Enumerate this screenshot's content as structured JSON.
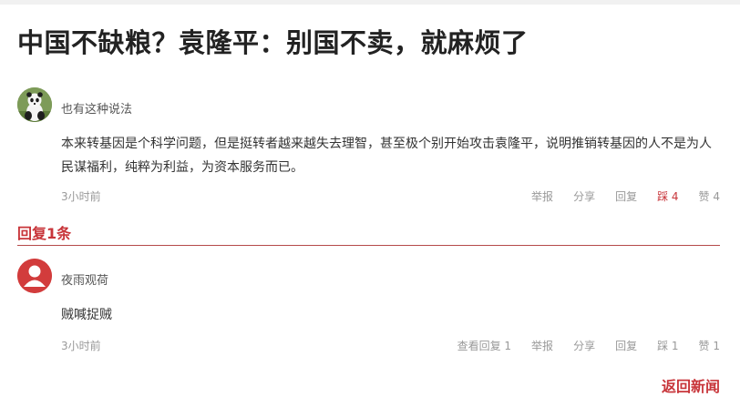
{
  "article": {
    "title": "中国不缺粮？袁隆平：别国不卖，就麻烦了"
  },
  "comment": {
    "avatar_icon": "panda-avatar-icon",
    "username": "也有这种说法",
    "text": "本来转基因是个科学问题，但是挺转者越来越失去理智，甚至极个别开始攻击袁隆平，说明推销转基因的人不是为人民谋福利，纯粹为利益，为资本服务而已。",
    "time": "3小时前",
    "actions": {
      "report": "举报",
      "share": "分享",
      "reply": "回复",
      "dislike": "踩 4",
      "like": "赞 4"
    }
  },
  "replies_section": {
    "title": "回复1条",
    "accent_color": "#c8353a"
  },
  "reply": {
    "avatar_icon": "default-user-avatar-icon",
    "username": "夜雨观荷",
    "text": "贼喊捉贼",
    "time": "3小时前",
    "actions": {
      "view_replies": "查看回复 1",
      "report": "举报",
      "share": "分享",
      "reply": "回复",
      "dislike": "踩 1",
      "like": "赞 1"
    }
  },
  "footer": {
    "back_label": "返回新闻"
  }
}
